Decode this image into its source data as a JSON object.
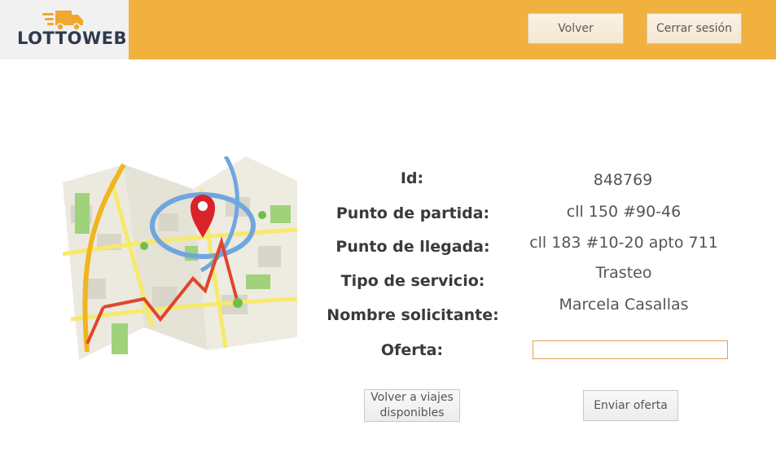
{
  "header": {
    "logo_text": "LOTTOWEB",
    "logo_icon": "truck-icon",
    "back_label": "Volver",
    "logout_label": "Cerrar sesión",
    "bar_color": "#f0b13f"
  },
  "trip": {
    "id_label": "Id:",
    "id_value": "848769",
    "origin_label": "Punto de partida:",
    "origin_value": "cll 150 #90-46",
    "destination_label": "Punto de llegada:",
    "destination_value": "cll 183 #10-20 apto 711",
    "service_label": "Tipo de servicio:",
    "service_value": "Trasteo",
    "requester_label": "Nombre solicitante:",
    "requester_value": "Marcela Casallas",
    "offer_label": "Oferta:",
    "offer_value": ""
  },
  "map": {
    "icon": "map-pin-icon"
  },
  "actions": {
    "back_to_trips_label": "Volver a viajes disponibles",
    "send_offer_label": "Enviar oferta"
  }
}
